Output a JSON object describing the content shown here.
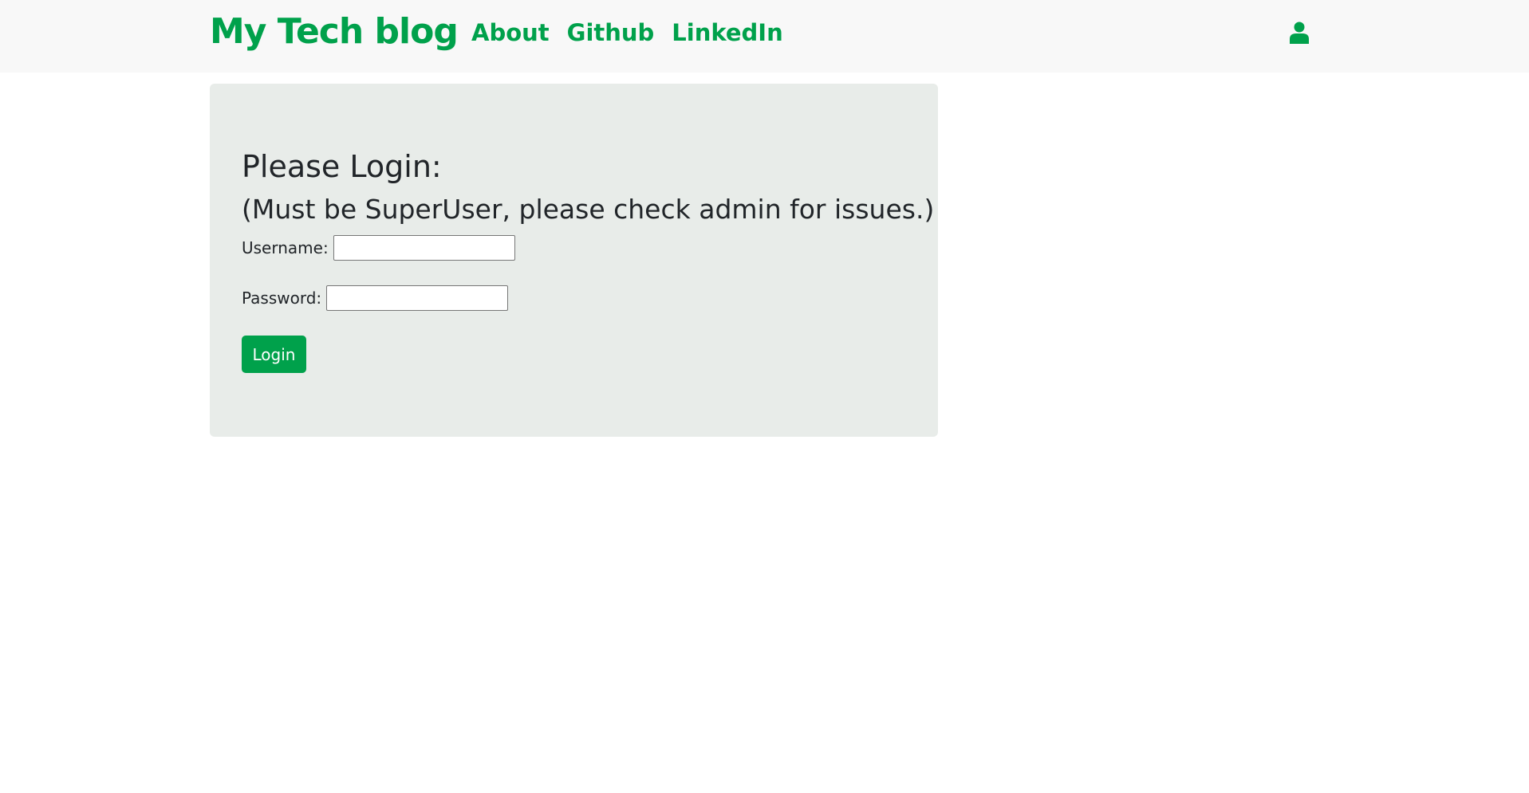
{
  "navbar": {
    "brand": "My Tech blog",
    "links": [
      {
        "label": "About"
      },
      {
        "label": "Github"
      },
      {
        "label": "LinkedIn"
      }
    ],
    "user_icon": "user-icon"
  },
  "login": {
    "title": "Please Login:",
    "subtitle": "(Must be SuperUser, please check admin for issues.)",
    "username_label": "Username:",
    "username_value": "",
    "password_label": "Password:",
    "password_value": "",
    "submit_label": "Login"
  },
  "colors": {
    "brand_green": "#00a14b",
    "navbar_bg": "#f8f8f8",
    "card_bg": "#e8ece9",
    "text": "#212529"
  }
}
